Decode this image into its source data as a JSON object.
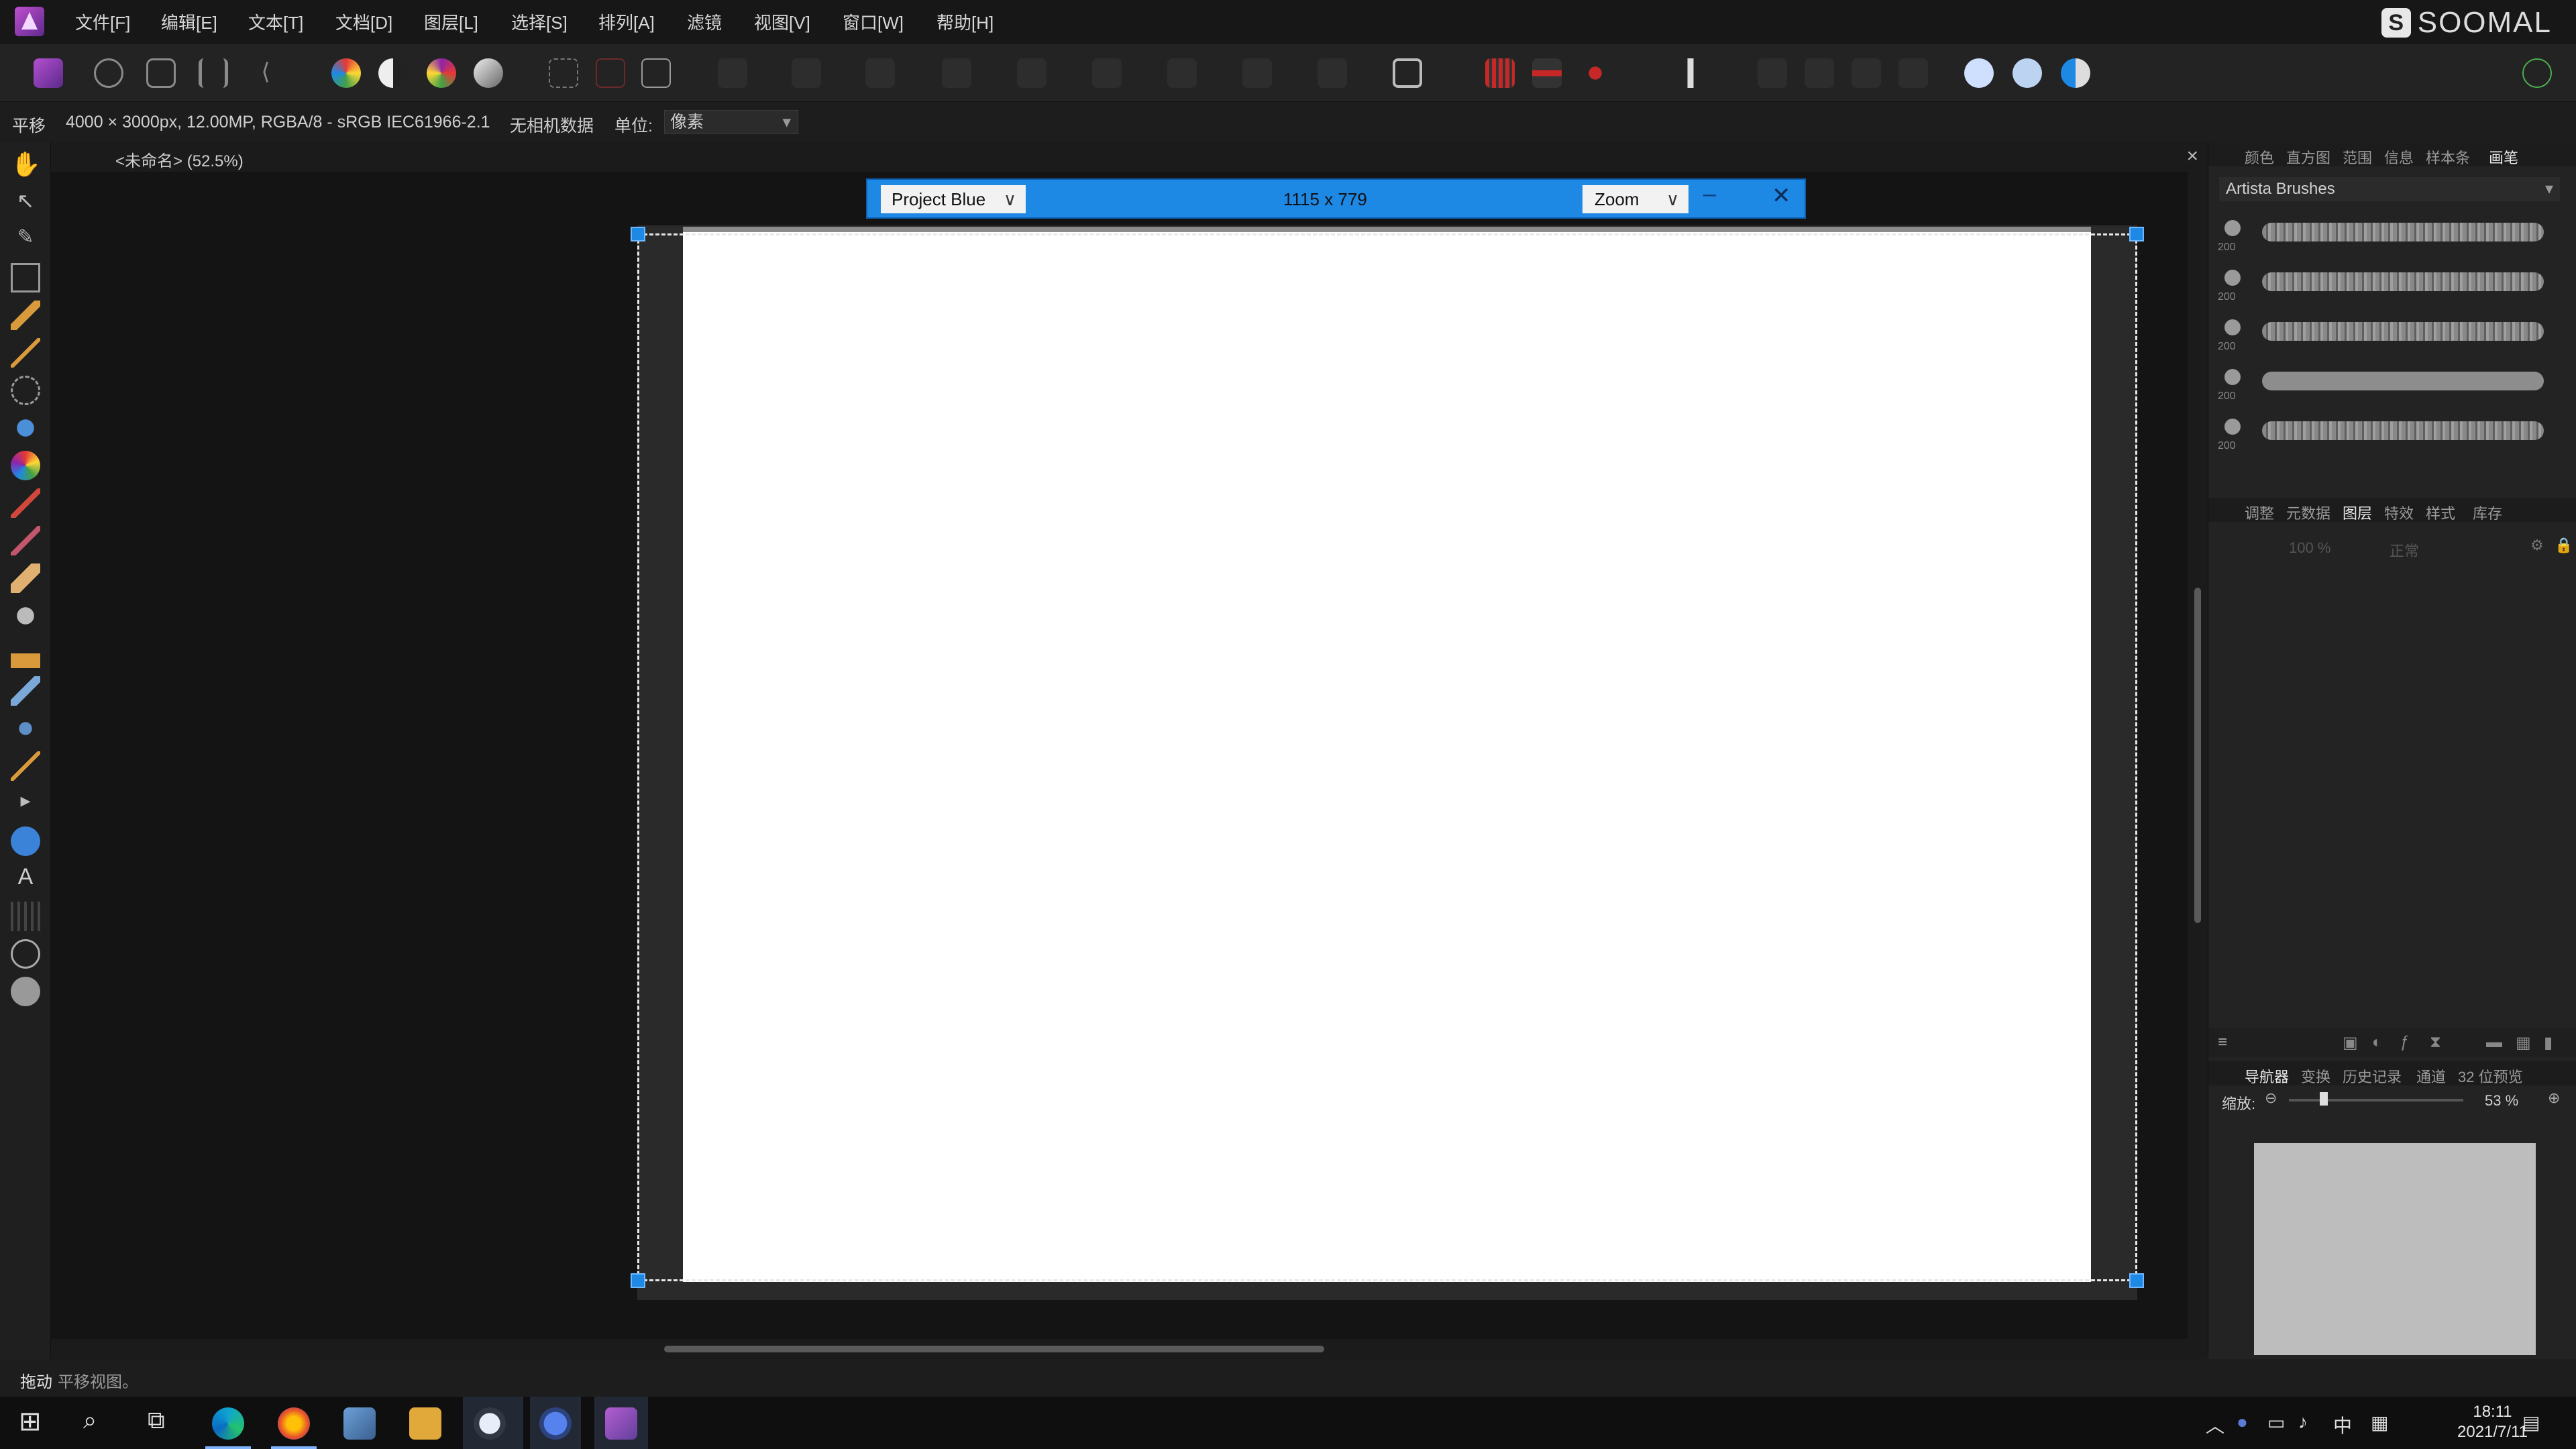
{
  "menubar": {
    "items": [
      "文件[F]",
      "编辑[E]",
      "文本[T]",
      "文档[D]",
      "图层[L]",
      "选择[S]",
      "排列[A]",
      "滤镜",
      "视图[V]",
      "窗口[W]",
      "帮助[H]"
    ],
    "brand": "SOOMAL",
    "brand_icon": "S"
  },
  "contextbar": {
    "tool": "平移",
    "doc_info": "4000 × 3000px, 12.00MP, RGBA/8 - sRGB IEC61966-2.1",
    "camera": "无相机数据",
    "unit_label": "单位:",
    "unit_value": "像素"
  },
  "document": {
    "tab_label": "<未命名> (52.5%)",
    "close": "×"
  },
  "overlay": {
    "project_select": "Project Blue",
    "size": "1115 x 779",
    "zoom_select": "Zoom",
    "minimize": "–",
    "close": "✕"
  },
  "right_panels": {
    "top_tabs": [
      "颜色",
      "直方图",
      "范围",
      "信息",
      "样本条",
      "画笔"
    ],
    "active_top_tab": "画笔",
    "brush_category": "Artista Brushes",
    "brush_sizes": [
      "200",
      "200",
      "200",
      "200",
      "200"
    ],
    "mid_tabs": [
      "调整",
      "元数据",
      "图层",
      "特效",
      "样式",
      "库存"
    ],
    "active_mid_tab": "图层",
    "opacity": "100 %",
    "blend_mode": "正常",
    "bottom_tabs": [
      "导航器",
      "变换",
      "历史记录",
      "通道",
      "32 位预览"
    ],
    "active_bottom_tab": "导航器",
    "zoom_label": "缩放:",
    "zoom_value": "53 %"
  },
  "statusbar": {
    "action": "拖动",
    "hint": "平移视图。"
  },
  "taskbar": {
    "ime": "中",
    "time": "18:11",
    "date": "2021/7/11"
  },
  "colors": {
    "accent_blue": "#1e88e5",
    "affinity_purple": "#8e3fbf"
  }
}
